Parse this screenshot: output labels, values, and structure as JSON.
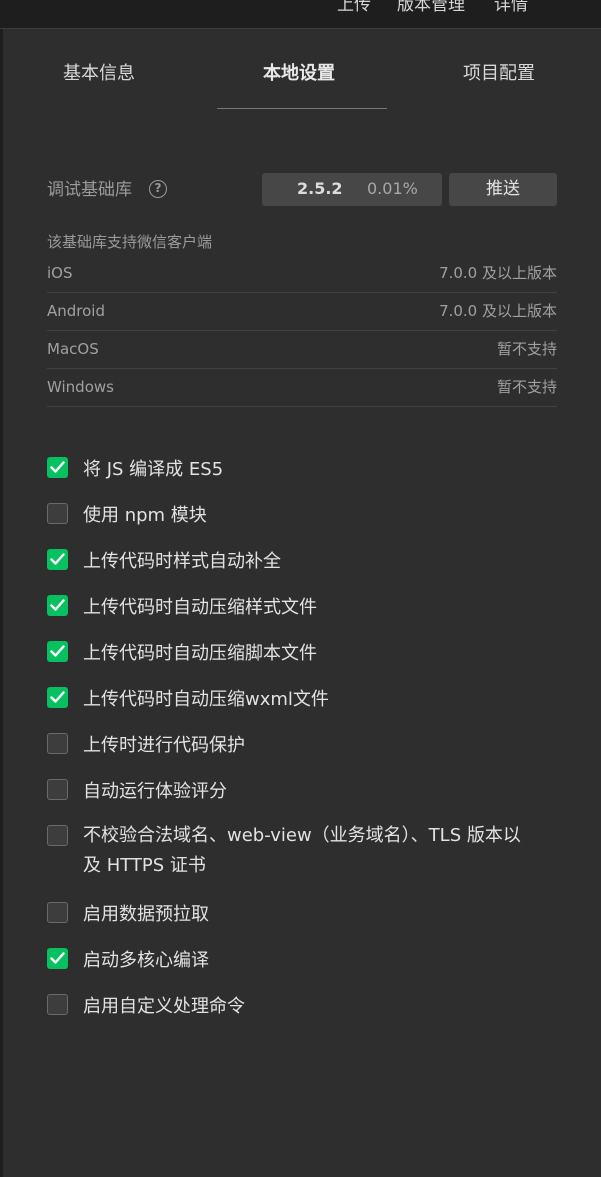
{
  "topbar": {
    "items": [
      "上传",
      "版本管理",
      "详情"
    ]
  },
  "tabs": [
    {
      "label": "基本信息",
      "active": false
    },
    {
      "label": "本地设置",
      "active": true
    },
    {
      "label": "项目配置",
      "active": false
    }
  ],
  "library": {
    "label": "调试基础库",
    "help_icon": "question-circle-icon",
    "version": "2.5.2",
    "percent": "0.01%",
    "push_label": "推送"
  },
  "support": {
    "title": "该基础库支持微信客户端",
    "platforms": [
      {
        "name": "iOS",
        "status": "7.0.0 及以上版本"
      },
      {
        "name": "Android",
        "status": "7.0.0 及以上版本"
      },
      {
        "name": "MacOS",
        "status": "暂不支持"
      },
      {
        "name": "Windows",
        "status": "暂不支持"
      }
    ]
  },
  "options": [
    {
      "label": "将 JS 编译成 ES5",
      "checked": true
    },
    {
      "label": "使用 npm 模块",
      "checked": false
    },
    {
      "label": "上传代码时样式自动补全",
      "checked": true
    },
    {
      "label": "上传代码时自动压缩样式文件",
      "checked": true
    },
    {
      "label": "上传代码时自动压缩脚本文件",
      "checked": true
    },
    {
      "label": "上传代码时自动压缩wxml文件",
      "checked": true
    },
    {
      "label": "上传时进行代码保护",
      "checked": false
    },
    {
      "label": "自动运行体验评分",
      "checked": false
    },
    {
      "label": "不校验合法域名、web-view（业务域名）、TLS 版本以及 HTTPS 证书",
      "checked": false
    },
    {
      "label": "启用数据预拉取",
      "checked": false
    },
    {
      "label": "启动多核心编译",
      "checked": true
    },
    {
      "label": "启用自定义处理命令",
      "checked": false
    }
  ],
  "colors": {
    "accent": "#07c160",
    "panel_bg": "#2e2e2e",
    "button_bg": "#474747"
  }
}
